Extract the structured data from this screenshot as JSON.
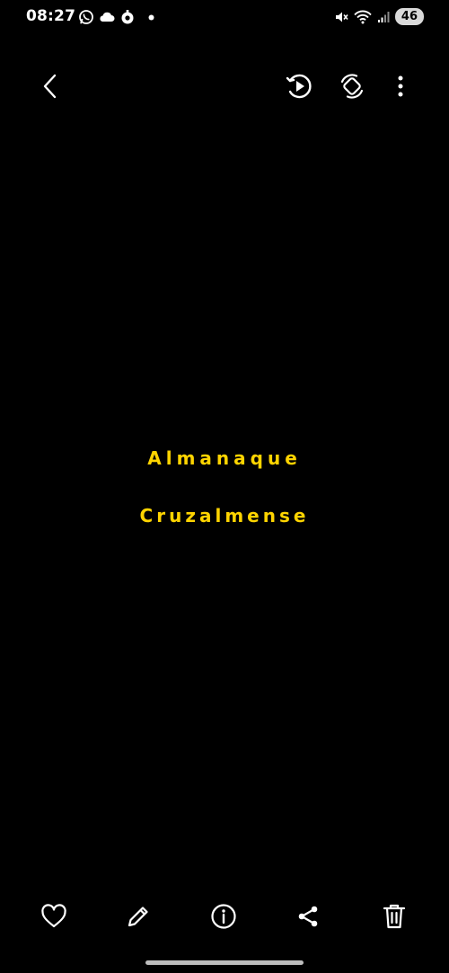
{
  "status_bar": {
    "time": "08:27",
    "left_icons": [
      "whatsapp-icon",
      "cloud-icon",
      "notification-icon",
      "dot-icon"
    ],
    "right_icons": [
      "mute-icon",
      "wifi-icon",
      "signal-icon"
    ],
    "battery": "46"
  },
  "toolbar": {
    "back_icon": "chevron-left-icon",
    "actions": [
      "play-motion-icon",
      "auto-rotate-icon",
      "more-vert-icon"
    ]
  },
  "content": {
    "line1": "Almanaque",
    "line2": "Cruzalmense",
    "text_color": "#ffd400",
    "background_color": "#000000"
  },
  "bottom_bar": {
    "actions": [
      "favorite-icon",
      "edit-icon",
      "info-icon",
      "share-icon",
      "delete-icon"
    ]
  }
}
